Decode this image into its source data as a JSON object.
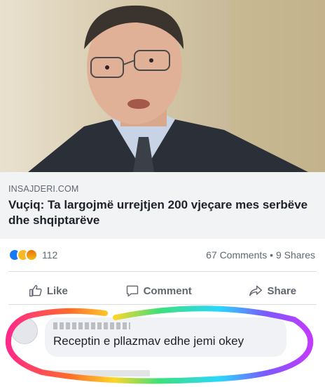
{
  "post": {
    "source": "INSAJDERI.COM",
    "headline": "Vuçiq: Ta largojmë urrejtjen 200 vjeçare mes serbëve dhe shqiptarëve"
  },
  "engagement": {
    "reaction_count": "112",
    "comments": "67 Comments",
    "separator": "•",
    "shares": "9 Shares",
    "reaction_icons": [
      "like",
      "haha",
      "angry"
    ]
  },
  "actions": {
    "like": "Like",
    "comment": "Comment",
    "share": "Share"
  },
  "comment": {
    "text": "Receptin e pllazmav edhe jemi okey"
  },
  "colors": {
    "accent": "#1877f2",
    "text_muted": "#606770"
  }
}
